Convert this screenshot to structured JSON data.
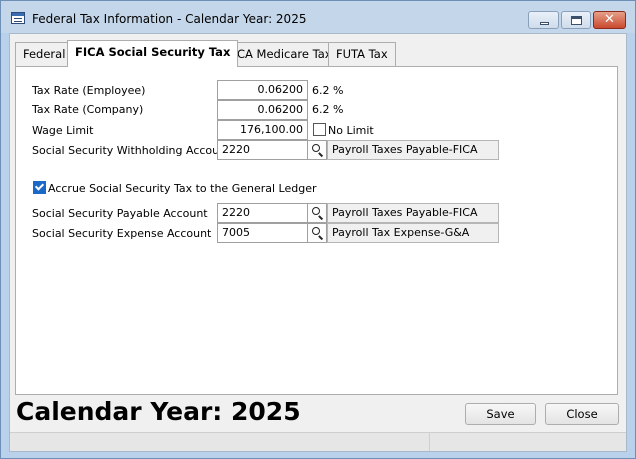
{
  "window": {
    "title": "Federal Tax Information - Calendar Year: 2025"
  },
  "tabs": [
    {
      "label": "Federal"
    },
    {
      "label": "FICA Social Security Tax"
    },
    {
      "label": "FICA Medicare Tax"
    },
    {
      "label": "FUTA Tax"
    }
  ],
  "active_tab": "FICA Social Security Tax",
  "form": {
    "employee_rate": {
      "label": "Tax Rate (Employee)",
      "value": "0.06200",
      "pct": "6.2 %"
    },
    "company_rate": {
      "label": "Tax Rate (Company)",
      "value": "0.06200",
      "pct": "6.2 %"
    },
    "wage_limit": {
      "label": "Wage Limit",
      "value": "176,100.00",
      "no_limit_label": "No Limit",
      "no_limit_checked": false
    },
    "withholding": {
      "label": "Social Security Withholding Account",
      "account": "2220",
      "description": "Payroll Taxes Payable-FICA"
    },
    "accrue": {
      "label": "Accrue Social Security Tax to the General Ledger",
      "checked": true
    },
    "payable": {
      "label": "Social Security Payable Account",
      "account": "2220",
      "description": "Payroll Taxes Payable-FICA"
    },
    "expense": {
      "label": "Social Security Expense Account",
      "account": "7005",
      "description": "Payroll Tax Expense-G&A"
    }
  },
  "footer": {
    "calendar_title": "Calendar Year: 2025",
    "save_label": "Save",
    "close_label": "Close"
  },
  "icons": {
    "lookup": "magnifier-icon",
    "app": "form-icon"
  }
}
